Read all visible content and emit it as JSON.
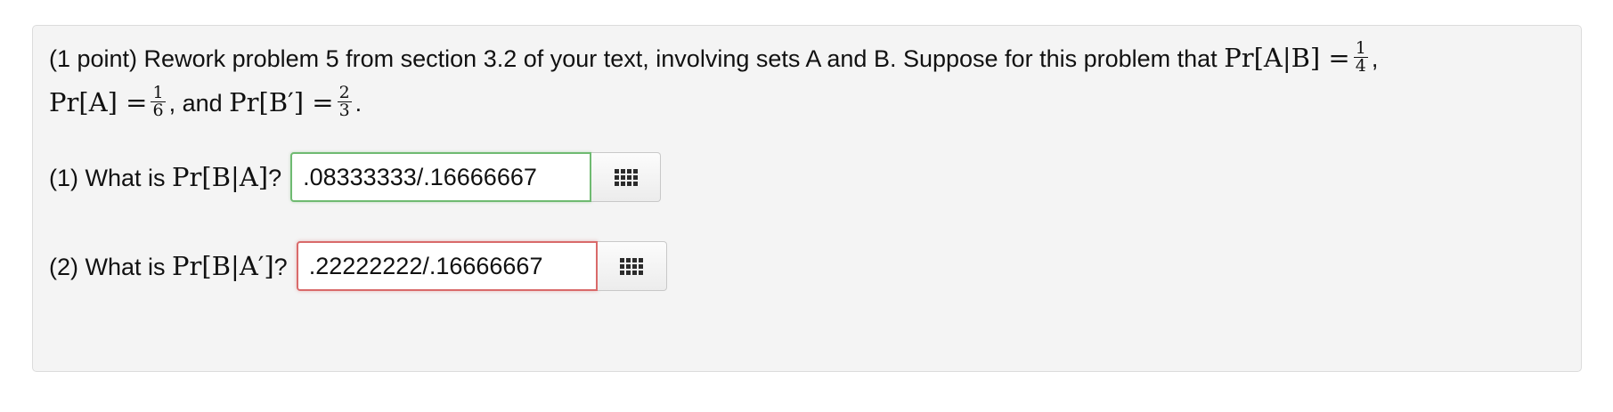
{
  "problem": {
    "intro": "(1 point) Rework problem 5 from section 3.2 of your text, involving sets A and B. Suppose for this problem that",
    "pr_a_given_b": "Pr[A|B] =",
    "pr_a_given_b_num": "1",
    "pr_a_given_b_den": "4",
    "comma1": ",",
    "pr_a": "Pr[A] =",
    "pr_a_num": "1",
    "pr_a_den": "6",
    "and_text": ", and",
    "pr_b_comp": "Pr[B′] =",
    "pr_b_comp_num": "2",
    "pr_b_comp_den": "3",
    "period": "."
  },
  "questions": [
    {
      "prefix": "(1) What is",
      "math": "Pr[B|A]",
      "suffix": "?",
      "answer_value": ".08333333/.16666667",
      "status": "correct"
    },
    {
      "prefix": "(2) What is",
      "math": "Pr[B|A′]",
      "suffix": "?",
      "answer_value": ".22222222/.16666667",
      "status": "incorrect"
    }
  ],
  "palette_icon": "equation-palette-icon",
  "colors": {
    "panel_background": "#f4f4f4",
    "correct_border": "#6fba71",
    "incorrect_border": "#d96a6a"
  }
}
